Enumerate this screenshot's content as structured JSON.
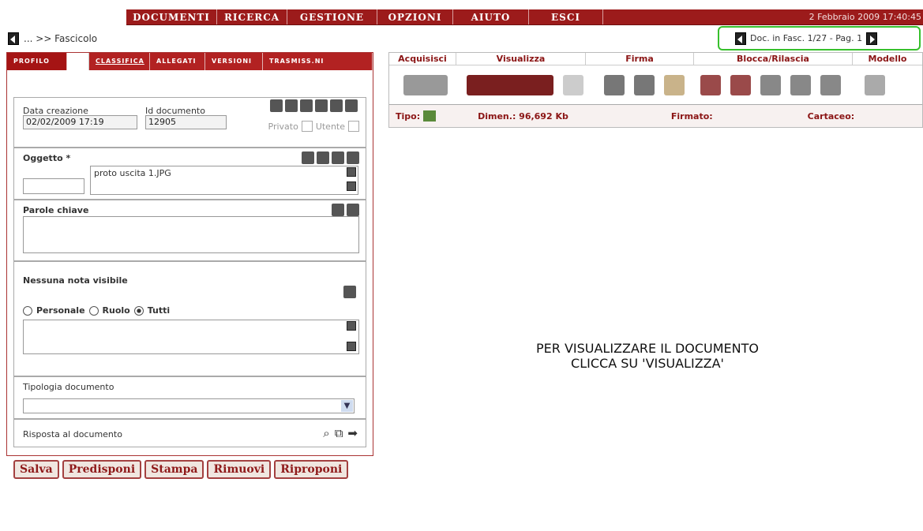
{
  "menu": {
    "items": [
      "DOCUMENTI",
      "RICERCA",
      "GESTIONE",
      "OPZIONI",
      "AIUTO",
      "ESCI"
    ],
    "datetime": "2 Febbraio 2009 17:40:45"
  },
  "breadcrumb": "... >> Fascicolo",
  "nav": {
    "label": "Doc. in Fasc. 1/27 - Pag. 1"
  },
  "tabs": [
    "PROFILO",
    "CLASSIFICA",
    "ALLEGATI",
    "VERSIONI",
    "TRASMISS.NI"
  ],
  "profile": {
    "data_creazione_label": "Data creazione",
    "data_creazione_value": "02/02/2009 17:19",
    "id_documento_label": "Id documento",
    "id_documento_value": "12905",
    "privato_label": "Privato",
    "utente_label": "Utente",
    "oggetto_label": "Oggetto *",
    "oggetto_value": "proto uscita 1.JPG",
    "parole_chiave_label": "Parole chiave",
    "note_label": "Nessuna nota visibile",
    "radio_personale": "Personale",
    "radio_ruolo": "Ruolo",
    "radio_tutti": "Tutti",
    "tipologia_label": "Tipologia documento",
    "risposta_label": "Risposta al documento"
  },
  "buttons": [
    "Salva",
    "Predisponi",
    "Stampa",
    "Rimuovi",
    "Riproponi"
  ],
  "toolbar": {
    "groups": [
      "Acquisisci",
      "Visualizza",
      "Firma",
      "Blocca/Rilascia",
      "Modello"
    ],
    "tipo_label": "Tipo:",
    "dimen_label": "Dimen.: 96,692 Kb",
    "firmato_label": "Firmato:",
    "cartaceo_label": "Cartaceo:"
  },
  "message": {
    "line1": "PER VISUALIZZARE IL DOCUMENTO",
    "line2": "CLICCA SU 'VISUALIZZA'"
  }
}
